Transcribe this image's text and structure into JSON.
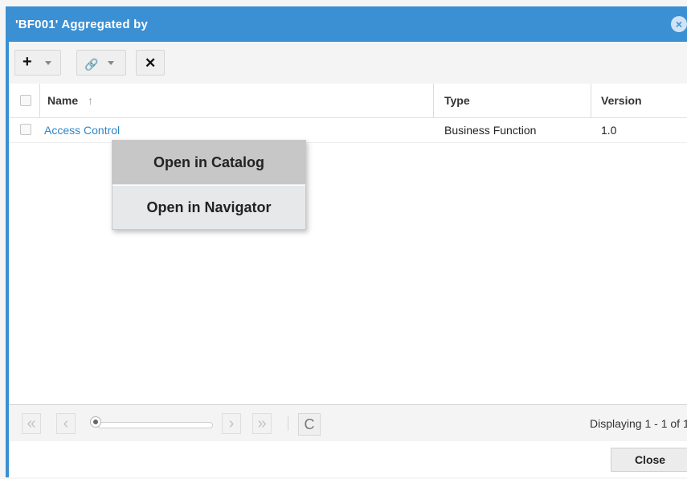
{
  "dialog": {
    "title": "'BF001' Aggregated by",
    "close_icon": "×"
  },
  "toolbar": {
    "add_icon": "+",
    "link_icon": "🔗",
    "delete_icon": "✕"
  },
  "grid": {
    "columns": [
      {
        "label": "Name",
        "sort_icon": "↑"
      },
      {
        "label": "Type"
      },
      {
        "label": "Version"
      }
    ],
    "rows": [
      {
        "name": "Access Control",
        "type": "Business Function",
        "version": "1.0"
      }
    ]
  },
  "context_menu": {
    "items": [
      {
        "label": "Open in Catalog"
      },
      {
        "label": "Open in Navigator"
      }
    ]
  },
  "pager": {
    "first_icon": "«",
    "prev_icon": "‹",
    "next_icon": "›",
    "last_icon": "»",
    "refresh_icon": "C",
    "display_text": "Displaying 1 - 1 of 1"
  },
  "footer": {
    "close_label": "Close"
  }
}
